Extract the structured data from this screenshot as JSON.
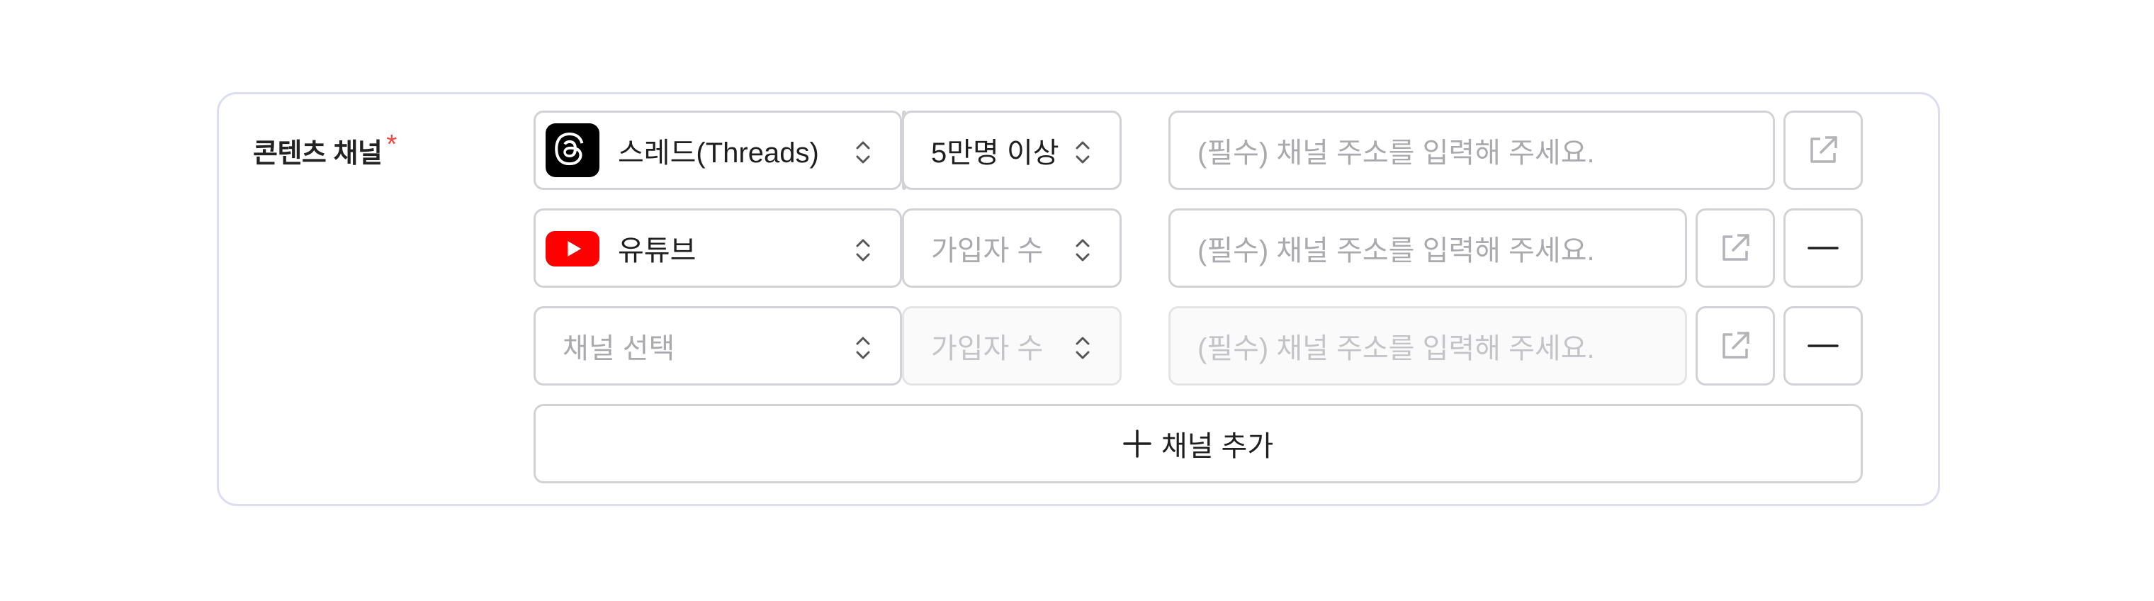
{
  "field": {
    "label": "콘텐츠 채널",
    "required_mark": "*"
  },
  "rows": [
    {
      "channel": "스레드(Threads)",
      "channel_icon": "threads-logo",
      "subscribers": "5만명 이상",
      "address_placeholder": "(필수) 채널 주소를 입력해 주세요."
    },
    {
      "channel": "유튜브",
      "channel_icon": "youtube-logo",
      "subscribers_placeholder": "가입자 수",
      "address_placeholder": "(필수) 채널 주소를 입력해 주세요."
    },
    {
      "channel_placeholder": "채널 선택",
      "subscribers_placeholder": "가입자 수",
      "address_placeholder": "(필수) 채널 주소를 입력해 주세요."
    }
  ],
  "add_button": {
    "label": "채널 추가",
    "icon": "plus-icon"
  },
  "colors": {
    "card_border": "#dcdcf3",
    "required": "#f0483e",
    "control_border": "#d2d2d6",
    "placeholder": "#a9a9ae",
    "youtube_red": "#ff0000"
  }
}
